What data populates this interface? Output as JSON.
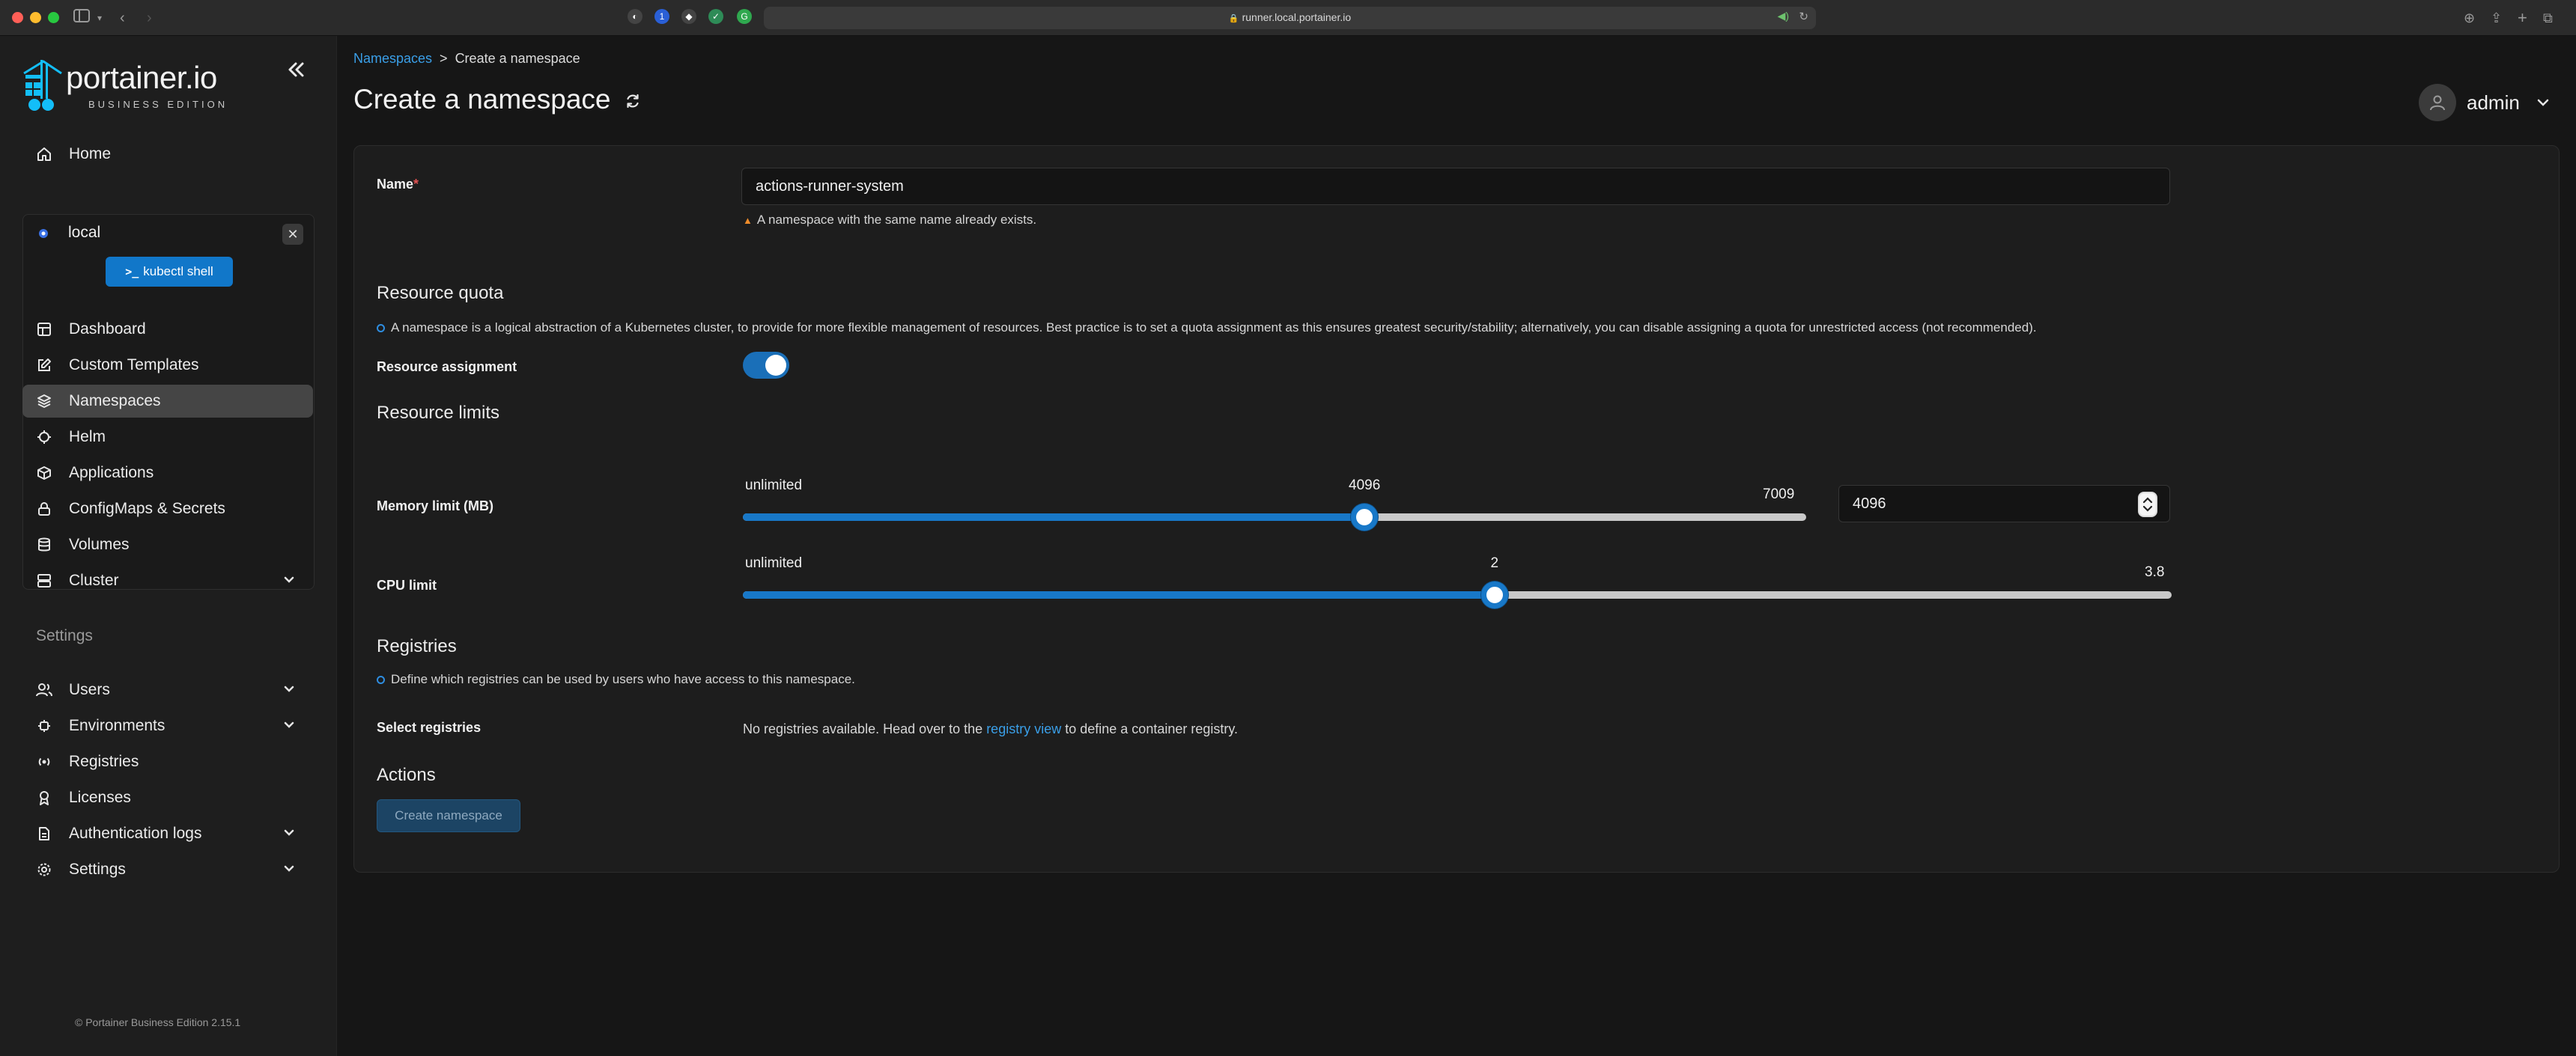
{
  "browser": {
    "url": "runner.local.portainer.io"
  },
  "sidebar": {
    "logo_text": "portainer.io",
    "logo_sub": "BUSINESS EDITION",
    "home_label": "Home",
    "environment": {
      "name": "local",
      "shell_button": "kubectl shell",
      "items": [
        {
          "label": "Dashboard",
          "icon": "dashboard-icon"
        },
        {
          "label": "Custom Templates",
          "icon": "edit-icon"
        },
        {
          "label": "Namespaces",
          "icon": "layers-icon",
          "active": true
        },
        {
          "label": "Helm",
          "icon": "helm-icon"
        },
        {
          "label": "Applications",
          "icon": "box-icon"
        },
        {
          "label": "ConfigMaps & Secrets",
          "icon": "lock-icon"
        },
        {
          "label": "Volumes",
          "icon": "database-icon"
        },
        {
          "label": "Cluster",
          "icon": "server-icon",
          "expandable": true
        }
      ]
    },
    "settings_heading": "Settings",
    "settings_items": [
      {
        "label": "Users",
        "icon": "users-icon",
        "expandable": true
      },
      {
        "label": "Environments",
        "icon": "environments-icon",
        "expandable": true
      },
      {
        "label": "Registries",
        "icon": "radio-icon"
      },
      {
        "label": "Licenses",
        "icon": "award-icon"
      },
      {
        "label": "Authentication logs",
        "icon": "file-text-icon",
        "expandable": true
      },
      {
        "label": "Settings",
        "icon": "gear-icon",
        "expandable": true
      }
    ],
    "footer": "© Portainer Business Edition  2.15.1"
  },
  "header": {
    "breadcrumb_link": "Namespaces",
    "breadcrumb_separator": ">",
    "breadcrumb_current": "Create a namespace",
    "title": "Create a namespace",
    "username": "admin"
  },
  "form": {
    "name_label": "Name",
    "name_required": "*",
    "name_value": "actions-runner-system",
    "name_warning": "A namespace with the same name already exists.",
    "resource_quota_heading": "Resource quota",
    "resource_quota_help": "A namespace is a logical abstraction of a Kubernetes cluster, to provide for more flexible management of resources. Best practice is to set a quota assignment as this ensures greatest security/stability; alternatively, you can disable assigning a quota for unrestricted access (not recommended).",
    "resource_assignment_label": "Resource assignment",
    "resource_assignment_enabled": true,
    "resource_limits_heading": "Resource limits",
    "memory": {
      "label": "Memory limit (MB)",
      "min_label": "unlimited",
      "value": 4096,
      "max": 7009,
      "value_text": "4096",
      "max_text": "7009",
      "input_value": "4096"
    },
    "cpu": {
      "label": "CPU limit",
      "min_label": "unlimited",
      "value": 2,
      "max": 3.8,
      "value_text": "2",
      "max_text": "3.8"
    },
    "registries_heading": "Registries",
    "registries_help": "Define which registries can be used by users who have access to this namespace.",
    "select_registries_label": "Select registries",
    "no_registries_prefix": "No registries available. Head over to the",
    "no_registries_link": "registry view",
    "no_registries_suffix": "to define a container registry.",
    "actions_heading": "Actions",
    "create_button": "Create namespace"
  },
  "colors": {
    "accent": "#1878c8",
    "link": "#3a9fe8",
    "warning": "#f08c2a",
    "background": "#161616"
  }
}
